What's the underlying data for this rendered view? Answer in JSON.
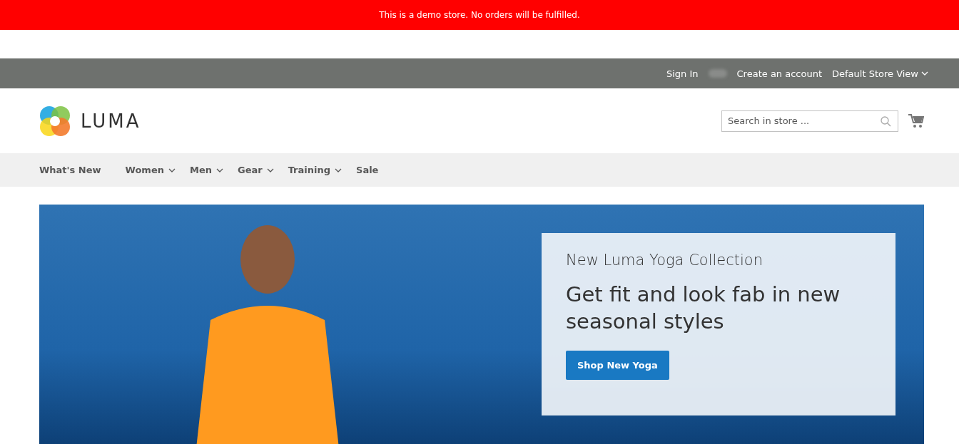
{
  "demo_notice": "This is a demo store. No orders will be fulfilled.",
  "top_links": {
    "sign_in": "Sign In",
    "create_account": "Create an account",
    "store_view": "Default Store View"
  },
  "logo": {
    "text": "LUMA"
  },
  "search": {
    "placeholder": "Search in store ..."
  },
  "nav": [
    {
      "label": "What's New",
      "dropdown": false
    },
    {
      "label": "Women",
      "dropdown": true
    },
    {
      "label": "Men",
      "dropdown": true
    },
    {
      "label": "Gear",
      "dropdown": true
    },
    {
      "label": "Training",
      "dropdown": true
    },
    {
      "label": "Sale",
      "dropdown": false
    }
  ],
  "hero": {
    "subtitle": "New Luma Yoga Collection",
    "headline": "Get fit and look fab in new seasonal styles",
    "button": "Shop New Yoga"
  }
}
